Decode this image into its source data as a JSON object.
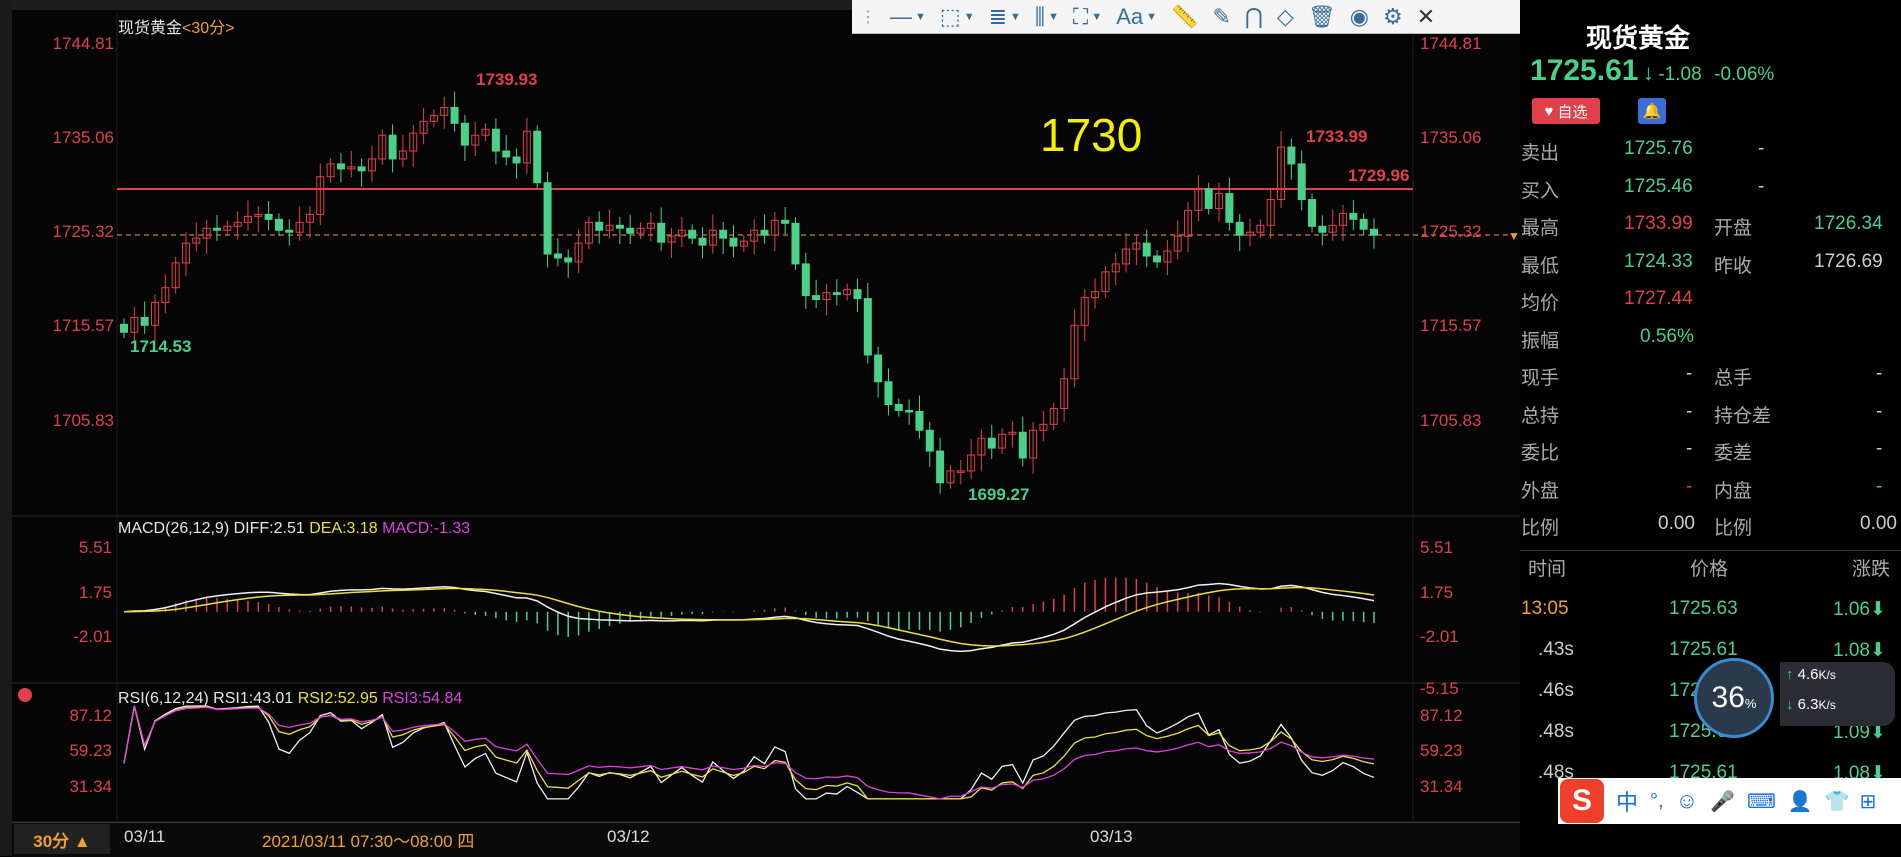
{
  "chart": {
    "symbol_title": "现货黄金",
    "period_tag": "<30分>",
    "price_axis_left": [
      "1744.81",
      "1735.06",
      "1725.32",
      "1715.57",
      "1705.83"
    ],
    "price_axis_right": [
      "1744.81",
      "1735.06",
      "1725.32",
      "1715.57",
      "1705.83"
    ],
    "annot_high": "1739.93",
    "annot_low": "1714.53",
    "annot_high2": "1733.99",
    "annot_line": "1729.96",
    "annot_bottom": "1699.27",
    "big_label": "1730",
    "macd_title": "MACD(26,12,9)",
    "macd_diff": "DIFF:2.51",
    "macd_dea": "DEA:3.18",
    "macd_val": "MACD:-1.33",
    "macd_axis_left": [
      "5.51",
      "1.75",
      "-2.01"
    ],
    "macd_axis_right": [
      "5.51",
      "1.75",
      "-2.01",
      "-5.15"
    ],
    "rsi_title": "RSI(6,12,24)",
    "rsi1": "RSI1:43.01",
    "rsi2": "RSI2:52.95",
    "rsi3": "RSI3:54.84",
    "rsi_axis_left": [
      "87.12",
      "59.23",
      "31.34"
    ],
    "rsi_axis_right": [
      "87.12",
      "59.23",
      "31.34"
    ],
    "period_button": "30分 ▲",
    "date_ticks": [
      "03/11",
      "03/12",
      "03/13"
    ],
    "cursor_time": "2021/03/11 07:30～08:00 四",
    "close_prices": [
      1715.5,
      1717,
      1716.2,
      1718.5,
      1720,
      1722.5,
      1724.5,
      1725,
      1726,
      1725.8,
      1726.2,
      1726.6,
      1727.2,
      1727.4,
      1726.9,
      1725.8,
      1725.6,
      1726.6,
      1727.4,
      1731.2,
      1732.5,
      1732,
      1732.2,
      1731.8,
      1733,
      1735.4,
      1733,
      1733.8,
      1735.6,
      1736.8,
      1737.4,
      1738.2,
      1736.6,
      1734.4,
      1735.4,
      1736,
      1733.8,
      1733.2,
      1732.6,
      1735.8,
      1730.6,
      1723.4,
      1723,
      1722.6,
      1724.5,
      1726.6,
      1725.8,
      1726.3,
      1726,
      1725.5,
      1726,
      1726.5,
      1724.6,
      1725.2,
      1725.8,
      1725,
      1724.3,
      1725.8,
      1725,
      1724.2,
      1724.7,
      1725.8,
      1725.3,
      1726.8,
      1726.5,
      1722.4,
      1719.2,
      1718.8,
      1719.5,
      1719.3,
      1719.8,
      1718.9,
      1713.2,
      1710.5,
      1708.2,
      1707.6,
      1707.5,
      1705.6,
      1703.5,
      1700.3,
      1701.5,
      1701.5,
      1703.1,
      1704.8,
      1703.8,
      1705.2,
      1705.4,
      1702.8,
      1705.6,
      1706.2,
      1707.8,
      1710.8,
      1716.2,
      1719,
      1719.6,
      1721.6,
      1722.4,
      1723.9,
      1724.5,
      1723.2,
      1722.6,
      1723.7,
      1725.2,
      1727.8,
      1730,
      1728,
      1729.5,
      1726.6,
      1725.3,
      1725.6,
      1726.3,
      1728.9,
      1734.2,
      1732.5,
      1728.9,
      1726.2,
      1725.6,
      1726.3,
      1727.5,
      1726.9,
      1725.9,
      1725.3
    ]
  },
  "toolbar": {
    "items": [
      "line-tool",
      "rect-tool",
      "text-tool",
      "vlines-tool",
      "pattern-tool",
      "font-tool",
      "ruler",
      "pen",
      "magnet",
      "eraser",
      "trash",
      "eye",
      "settings",
      "close"
    ],
    "font_label": "Aa"
  },
  "quote": {
    "name": "现货黄金",
    "price": "1725.61",
    "arrow": "↓",
    "change": "-1.08",
    "change_pct": "-0.06%",
    "watch_label": "自选",
    "sell_label": "卖出",
    "sell_value": "1725.76",
    "sell_vol": "-",
    "buy_label": "买入",
    "buy_value": "1725.46",
    "buy_vol": "-",
    "high_label": "最高",
    "high_value": "1733.99",
    "open_label": "开盘",
    "open_value": "1726.34",
    "low_label": "最低",
    "low_value": "1724.33",
    "prev_label": "昨收",
    "prev_value": "1726.69",
    "avg_label": "均价",
    "avg_value": "1727.44",
    "amp_label": "振幅",
    "amp_value": "0.56%",
    "cur_hand_label": "现手",
    "cur_hand_value": "-",
    "tot_hand_label": "总手",
    "tot_hand_value": "-",
    "tot_hold_label": "总持",
    "tot_hold_value": "-",
    "pos_diff_label": "持仓差",
    "pos_diff_value": "-",
    "bid_ratio_label": "委比",
    "bid_ratio_value": "-",
    "bid_diff_label": "委差",
    "bid_diff_value": "-",
    "outer_label": "外盘",
    "outer_value": "-",
    "inner_label": "内盘",
    "inner_value": "-",
    "ratio_label": "比例",
    "ratio_value": "0.00",
    "ratio2_label": "比例",
    "ratio2_value": "0.00"
  },
  "ticks": {
    "headers": [
      "时间",
      "价格",
      "涨跌"
    ],
    "rows": [
      {
        "time": "13:05",
        "price": "1725.63",
        "chg": "1.06"
      },
      {
        "time": ".43s",
        "price": "1725.61",
        "chg": "1.08"
      },
      {
        "time": ".46s",
        "price": "1725.",
        "chg": ""
      },
      {
        "time": ".48s",
        "price": "1725.60",
        "chg": "1.09"
      },
      {
        "time": ".48s",
        "price": "1725.61",
        "chg": "1.08"
      }
    ]
  },
  "net": {
    "percent": "36",
    "unit": "%",
    "up": "4.6",
    "up_unit": "K/s",
    "down": "6.3",
    "down_unit": "K/s"
  },
  "ime": {
    "items": [
      "中",
      "°,",
      "☺",
      "mic",
      "keyboard",
      "user",
      "shirt",
      "apps"
    ],
    "ime_label": "中"
  },
  "colors": {
    "up": "#e0404a",
    "down": "#4bd08a",
    "accent": "#f0a030",
    "yellow": "#f5f000"
  }
}
